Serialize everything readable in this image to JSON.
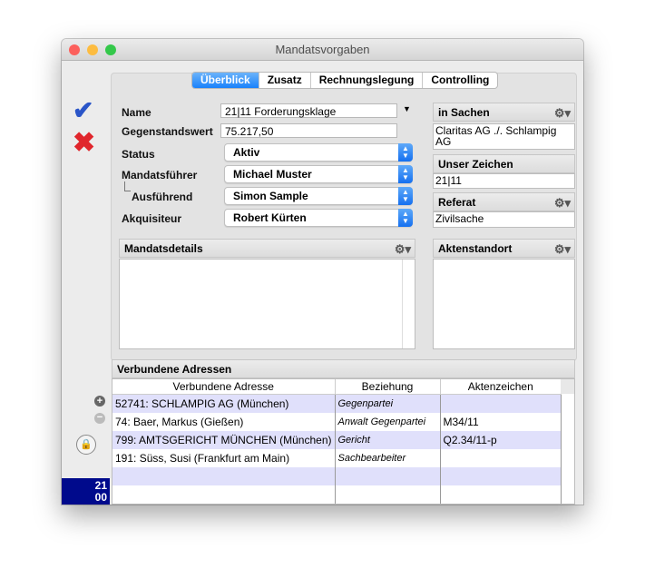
{
  "window": {
    "title": "Mandatsvorgaben"
  },
  "tabs": [
    "Überblick",
    "Zusatz",
    "Rechnungslegung",
    "Controlling"
  ],
  "active_tab": "Überblick",
  "form": {
    "name_label": "Name",
    "name_value": "21|11 Forderungsklage",
    "gegenstandswert_label": "Gegenstandswert",
    "gegenstandswert_value": "75.217,50",
    "status_label": "Status",
    "status_value": "Aktiv",
    "mandatsfuehrer_label": "Mandatsführer",
    "mandatsfuehrer_value": "Michael Muster",
    "ausfuehrend_label": "Ausführend",
    "ausfuehrend_value": "Simon Sample",
    "akquisiteur_label": "Akquisiteur",
    "akquisiteur_value": "Robert Kürten"
  },
  "right": {
    "in_sachen_label": "in Sachen",
    "in_sachen_value": "Claritas AG ./. Schlampig AG",
    "unser_zeichen_label": "Unser Zeichen",
    "unser_zeichen_value": "21|11",
    "referat_label": "Referat",
    "referat_value": "Zivilsache",
    "aktenstandort_label": "Aktenstandort"
  },
  "mandatsdetails_label": "Mandatsdetails",
  "addresses": {
    "title": "Verbundene Adressen",
    "columns": [
      "Verbundene Adresse",
      "Beziehung",
      "Aktenzeichen"
    ],
    "rows": [
      [
        "52741: SCHLAMPIG AG (München)",
        "Gegenpartei",
        ""
      ],
      [
        "74: Baer, Markus (Gießen)",
        "Anwalt Gegenpartei",
        "M34/11"
      ],
      [
        "799: AMTSGERICHT MÜNCHEN (München)",
        "Gericht",
        "Q2.34/11-p"
      ],
      [
        "191: Süss, Susi (Frankfurt am Main)",
        "Sachbearbeiter",
        ""
      ]
    ]
  },
  "badge": {
    "line1": "21",
    "line2": "00"
  },
  "colors": {
    "accent": "#1a82fb",
    "row_alt": "#e0e0fb",
    "badge": "#000a8c"
  }
}
